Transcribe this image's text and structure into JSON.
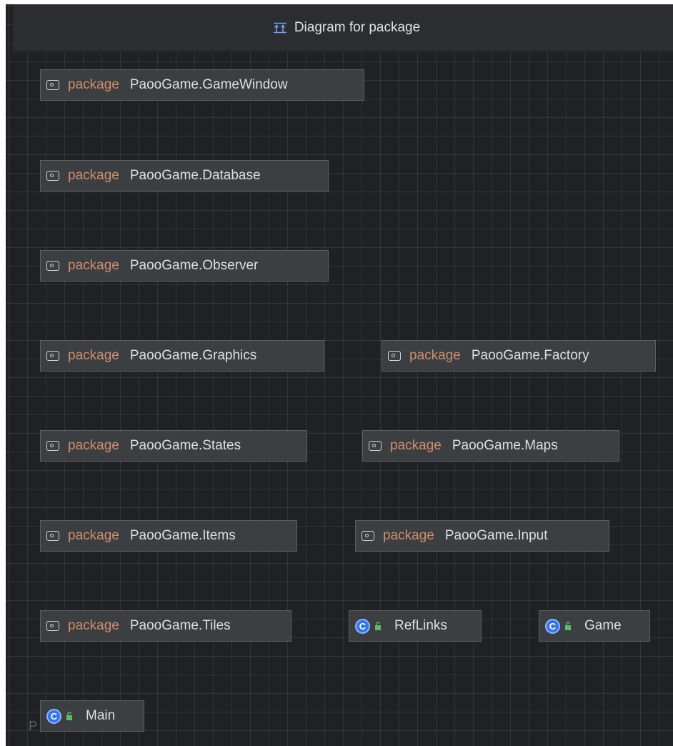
{
  "window": {
    "title": "Diagram for package",
    "title_icon": "class-hierarchy-icon"
  },
  "packages": [
    {
      "keyword": "package",
      "name": "PaooGame.GameWindow",
      "icon": "package-folder-icon"
    },
    {
      "keyword": "package",
      "name": "PaooGame.Database",
      "icon": "package-folder-icon"
    },
    {
      "keyword": "package",
      "name": "PaooGame.Observer",
      "icon": "package-folder-icon"
    },
    {
      "keyword": "package",
      "name": "PaooGame.Graphics",
      "icon": "package-folder-icon"
    },
    {
      "keyword": "package",
      "name": "PaooGame.Factory",
      "icon": "package-folder-icon"
    },
    {
      "keyword": "package",
      "name": "PaooGame.States",
      "icon": "package-folder-icon"
    },
    {
      "keyword": "package",
      "name": "PaooGame.Maps",
      "icon": "package-folder-icon"
    },
    {
      "keyword": "package",
      "name": "PaooGame.Items",
      "icon": "package-folder-icon"
    },
    {
      "keyword": "package",
      "name": "PaooGame.Input",
      "icon": "package-folder-icon"
    },
    {
      "keyword": "package",
      "name": "PaooGame.Tiles",
      "icon": "package-folder-icon"
    }
  ],
  "classes": [
    {
      "name": "RefLinks",
      "badge": "C",
      "icon": "class-icon",
      "access_icon": "public-lock-icon"
    },
    {
      "name": "Game",
      "badge": "C",
      "icon": "class-icon",
      "access_icon": "public-lock-icon"
    },
    {
      "name": "Main",
      "badge": "C",
      "icon": "class-icon",
      "access_icon": "public-lock-icon"
    }
  ],
  "footer_ghost_text": "P                s",
  "colors": {
    "canvas_background": "#202124",
    "header_background": "#2b2d30",
    "node_background": "#3c3f41",
    "node_border": "#5b5e62",
    "package_keyword": "#cf8e6d",
    "class_badge": "#3574f0",
    "lock": "#5fb865"
  }
}
